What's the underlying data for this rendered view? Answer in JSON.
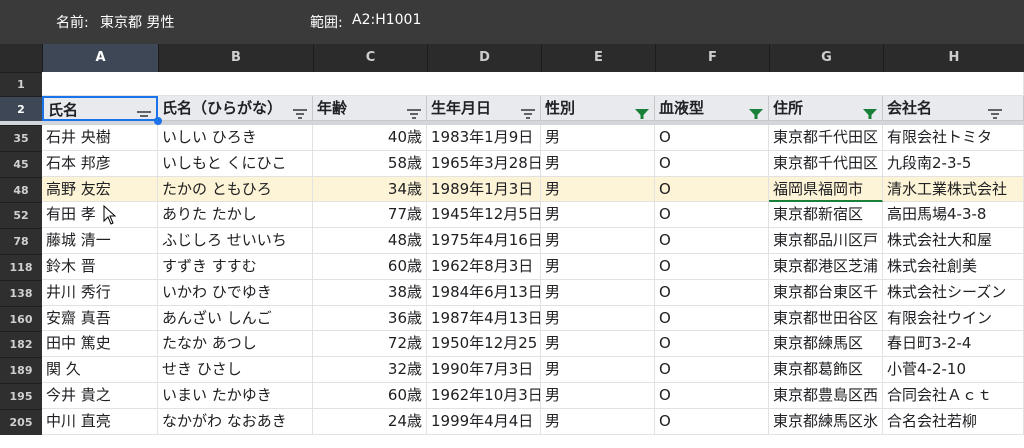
{
  "namebox": {
    "label": "名前:",
    "value": "東京都 男性"
  },
  "range": {
    "label": "範囲:",
    "value": "A2:H1001"
  },
  "columns": [
    "A",
    "B",
    "C",
    "D",
    "E",
    "F",
    "G",
    "H"
  ],
  "header_row_number": "1",
  "filter_row_number": "2",
  "headers": [
    "氏名",
    "氏名（ひらがな）",
    "年齢",
    "生年月日",
    "性別",
    "血液型",
    "住所",
    "会社名"
  ],
  "rows": [
    {
      "n": "35",
      "c": [
        "石井 央樹",
        "いしい ひろき",
        "40歳",
        "1983年1月9日",
        "男",
        "O",
        "東京都千代田区",
        "有限会社トミタ"
      ]
    },
    {
      "n": "45",
      "c": [
        "石本 邦彦",
        "いしもと くにひこ",
        "58歳",
        "1965年3月28日",
        "男",
        "O",
        "東京都千代田区",
        "九段南2-3-5"
      ]
    },
    {
      "n": "48",
      "c": [
        "高野 友宏",
        "たかの ともひろ",
        "34歳",
        "1989年1月3日",
        "男",
        "O",
        "福岡県福岡市",
        "清水工業株式会社"
      ]
    },
    {
      "n": "52",
      "c": [
        "有田 孝",
        "ありた たかし",
        "77歳",
        "1945年12月5日",
        "男",
        "O",
        "東京都新宿区",
        "高田馬場4-3-8"
      ]
    },
    {
      "n": "78",
      "c": [
        "藤城 清一",
        "ふじしろ せいいち",
        "48歳",
        "1975年4月16日",
        "男",
        "O",
        "東京都品川区戸",
        "株式会社大和屋"
      ]
    },
    {
      "n": "118",
      "c": [
        "鈴木 晋",
        "すずき すすむ",
        "60歳",
        "1962年8月3日",
        "男",
        "O",
        "東京都港区芝浦",
        "株式会社創美"
      ]
    },
    {
      "n": "138",
      "c": [
        "井川 秀行",
        "いかわ ひでゆき",
        "38歳",
        "1984年6月13日",
        "男",
        "O",
        "東京都台東区千",
        "株式会社シーズン"
      ]
    },
    {
      "n": "160",
      "c": [
        "安齋 真吾",
        "あんざい しんご",
        "36歳",
        "1987年4月13日",
        "男",
        "O",
        "東京都世田谷区",
        "有限会社ウイン"
      ]
    },
    {
      "n": "182",
      "c": [
        "田中 篤史",
        "たなか あつし",
        "72歳",
        "1950年12月25日",
        "男",
        "O",
        "東京都練馬区",
        "春日町3-2-4"
      ]
    },
    {
      "n": "189",
      "c": [
        "関 久",
        "せき ひさし",
        "32歳",
        "1990年7月3日",
        "男",
        "O",
        "東京都葛飾区",
        "小菅4-2-10"
      ]
    },
    {
      "n": "195",
      "c": [
        "今井 貴之",
        "いまい たかゆき",
        "60歳",
        "1962年10月3日",
        "男",
        "O",
        "東京都豊島区西",
        "合同会社Ａｃｔ"
      ]
    },
    {
      "n": "205",
      "c": [
        "中川 直亮",
        "なかがわ なおあき",
        "24歳",
        "1999年4月4日",
        "男",
        "O",
        "東京都練馬区氷",
        "合名会社若柳"
      ]
    }
  ],
  "filters_active": [
    false,
    false,
    false,
    false,
    true,
    true,
    true,
    false
  ],
  "colors": {
    "filter_active": "#188038",
    "selection": "#1a73e8",
    "highlight": "#fdf3d6"
  }
}
